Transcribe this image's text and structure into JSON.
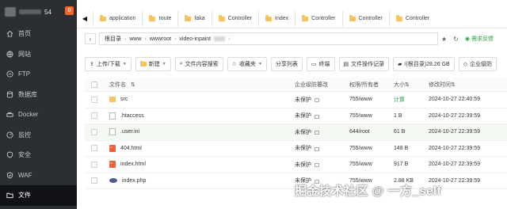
{
  "sidebar": {
    "host_suffix": "54",
    "badge": "0",
    "items": [
      {
        "label": "首页",
        "icon": "home-icon"
      },
      {
        "label": "网站",
        "icon": "globe-icon"
      },
      {
        "label": "FTP",
        "icon": "ftp-icon"
      },
      {
        "label": "数据库",
        "icon": "database-icon"
      },
      {
        "label": "Docker",
        "icon": "docker-icon"
      },
      {
        "label": "监控",
        "icon": "monitor-icon"
      },
      {
        "label": "安全",
        "icon": "shield-icon"
      },
      {
        "label": "WAF",
        "icon": "waf-icon"
      },
      {
        "label": "文件",
        "icon": "folder-icon",
        "active": true
      }
    ]
  },
  "tabs": [
    "application",
    "route",
    "faka",
    "Controller",
    "Index",
    "Controller",
    "Controller",
    "Controller"
  ],
  "address": {
    "segments": [
      "根目录",
      "www",
      "wwwroot",
      "video-inpaint"
    ],
    "feedback": "需求反馈"
  },
  "toolbar": {
    "upload": "上传/下载",
    "new": "新建",
    "search_content": "文件内容搜索",
    "favorites": "收藏夹",
    "share": "分享列表",
    "endpoint": "终端",
    "op_log": "文件操作记录",
    "disk": "/(根目录)28.26 GB",
    "enterprise": "企业级防"
  },
  "table": {
    "headers": {
      "name": "文件名",
      "protect": "企业级防篡改",
      "perm": "权限/所有者",
      "size": "大小",
      "modified": "修改时间"
    },
    "rows": [
      {
        "name": "src",
        "type": "folder",
        "protect": "未保护",
        "perm": "755/www",
        "size": "计算",
        "modified": "2024-10-27 22:40:59"
      },
      {
        "name": ".htaccess",
        "type": "doc",
        "protect": "未保护",
        "perm": "755/www",
        "size": "1 B",
        "modified": "2024-10-27 22:39:59"
      },
      {
        "name": ".user.ini",
        "type": "doc",
        "protect": "未保护",
        "perm": "644/root",
        "size": "61 B",
        "modified": "2024-10-27 22:39:59"
      },
      {
        "name": "404.html",
        "type": "html",
        "protect": "未保护",
        "perm": "755/www",
        "size": "148 B",
        "modified": "2024-10-27 22:39:59"
      },
      {
        "name": "index.html",
        "type": "html",
        "protect": "未保护",
        "perm": "755/www",
        "size": "917 B",
        "modified": "2024-10-27 22:39:59"
      },
      {
        "name": "index.php",
        "type": "php",
        "protect": "未保护",
        "perm": "755/www",
        "size": "2.88 KB",
        "modified": "2024-10-27 22:39:59"
      }
    ]
  },
  "watermark": "掘金技术社区 @ 一方_self",
  "colors": {
    "sidebar_bg": "#2b2e33",
    "accent": "#20a53a",
    "badge": "#f0662b"
  }
}
